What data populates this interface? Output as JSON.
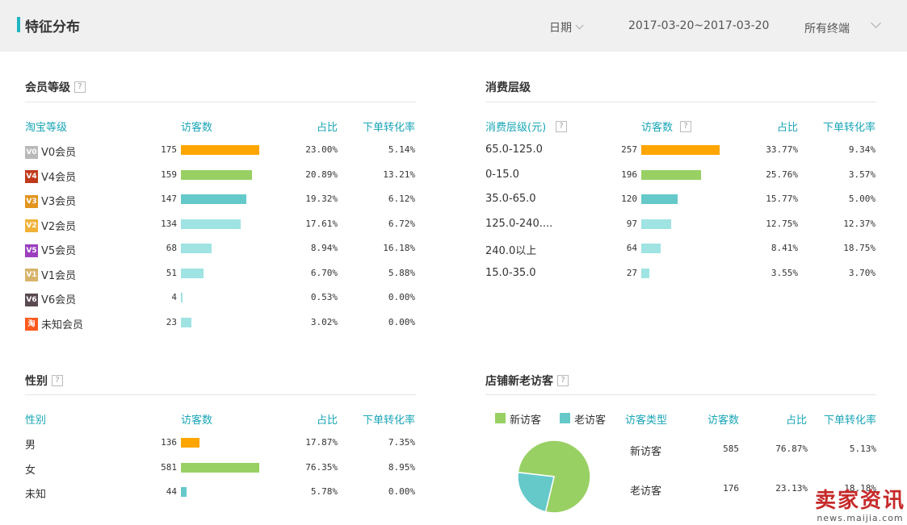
{
  "header": {
    "title": "特征分布",
    "date_label": "日期",
    "date_range": "2017-03-20~2017-03-20",
    "terminal_label": "所有终端"
  },
  "help_glyph": "?",
  "member": {
    "title": "会员等级",
    "headers": [
      "淘宝等级",
      "访客数",
      "占比",
      "下单转化率"
    ],
    "rows": [
      {
        "label": "V0会员",
        "badge": "V0",
        "badge_color": "#b9b9b9",
        "visitors": "175",
        "share": "23.00%",
        "rate": "5.14%",
        "bar_color": "#ffa500",
        "value": 175
      },
      {
        "label": "V4会员",
        "badge": "V4",
        "badge_color": "#c0391b",
        "visitors": "159",
        "share": "20.89%",
        "rate": "13.21%",
        "bar_color": "#99d064",
        "value": 159
      },
      {
        "label": "V3会员",
        "badge": "V3",
        "badge_color": "#e2951f",
        "visitors": "147",
        "share": "19.32%",
        "rate": "6.12%",
        "bar_color": "#65c9c9",
        "value": 147
      },
      {
        "label": "V2会员",
        "badge": "V2",
        "badge_color": "#f1b23a",
        "visitors": "134",
        "share": "17.61%",
        "rate": "6.72%",
        "bar_color": "#9fe3e3",
        "value": 134
      },
      {
        "label": "V5会员",
        "badge": "V5",
        "badge_color": "#9b3fbe",
        "visitors": "68",
        "share": "8.94%",
        "rate": "16.18%",
        "bar_color": "#9fe3e3",
        "value": 68
      },
      {
        "label": "V1会员",
        "badge": "V1",
        "badge_color": "#d8b46a",
        "visitors": "51",
        "share": "6.70%",
        "rate": "5.88%",
        "bar_color": "#9fe3e3",
        "value": 51
      },
      {
        "label": "V6会员",
        "badge": "V6",
        "badge_color": "#5a4a52",
        "visitors": "4",
        "share": "0.53%",
        "rate": "0.00%",
        "bar_color": "#9fe3e3",
        "value": 4
      },
      {
        "label": "未知会员",
        "badge": "淘",
        "badge_color": "#ff5a1f",
        "visitors": "23",
        "share": "3.02%",
        "rate": "0.00%",
        "bar_color": "#9fe3e3",
        "value": 23
      }
    ]
  },
  "consumption": {
    "title": "消费层级",
    "headers": [
      "消费层级(元)",
      "访客数",
      "占比",
      "下单转化率"
    ],
    "rows": [
      {
        "label": "65.0-125.0",
        "visitors": "257",
        "share": "33.77%",
        "rate": "9.34%",
        "bar_color": "#ffa500",
        "value": 257
      },
      {
        "label": "0-15.0",
        "visitors": "196",
        "share": "25.76%",
        "rate": "3.57%",
        "bar_color": "#99d064",
        "value": 196
      },
      {
        "label": "35.0-65.0",
        "visitors": "120",
        "share": "15.77%",
        "rate": "5.00%",
        "bar_color": "#65c9c9",
        "value": 120
      },
      {
        "label": "125.0-240....",
        "visitors": "97",
        "share": "12.75%",
        "rate": "12.37%",
        "bar_color": "#9fe3e3",
        "value": 97
      },
      {
        "label": "240.0以上",
        "visitors": "64",
        "share": "8.41%",
        "rate": "18.75%",
        "bar_color": "#9fe3e3",
        "value": 64
      },
      {
        "label": "15.0-35.0",
        "visitors": "27",
        "share": "3.55%",
        "rate": "3.70%",
        "bar_color": "#9fe3e3",
        "value": 27
      }
    ]
  },
  "gender": {
    "title": "性别",
    "headers": [
      "性别",
      "访客数",
      "占比",
      "下单转化率"
    ],
    "rows": [
      {
        "label": "男",
        "visitors": "136",
        "share": "17.87%",
        "rate": "7.35%",
        "bar_color": "#ffa500",
        "value": 136
      },
      {
        "label": "女",
        "visitors": "581",
        "share": "76.35%",
        "rate": "8.95%",
        "bar_color": "#99d064",
        "value": 581
      },
      {
        "label": "未知",
        "visitors": "44",
        "share": "5.78%",
        "rate": "0.00%",
        "bar_color": "#65c9c9",
        "value": 44
      }
    ]
  },
  "visitors": {
    "title": "店铺新老访客",
    "legend": [
      {
        "label": "新访客",
        "color": "#99d064"
      },
      {
        "label": "老访客",
        "color": "#65c9c9"
      }
    ],
    "headers": [
      "访客类型",
      "访客数",
      "占比",
      "下单转化率"
    ],
    "rows": [
      {
        "label": "新访客",
        "visitors": "585",
        "share": "76.87%",
        "rate": "5.13%"
      },
      {
        "label": "老访客",
        "visitors": "176",
        "share": "23.13%",
        "rate": "18.18%"
      }
    ]
  },
  "chart_data": {
    "type": "pie",
    "labels": [
      "新访客",
      "老访客"
    ],
    "values": [
      585,
      176
    ],
    "colors": [
      "#99d064",
      "#65c9c9"
    ]
  },
  "watermark": {
    "line1": "卖家资讯",
    "line2": "news.maijia.com"
  }
}
